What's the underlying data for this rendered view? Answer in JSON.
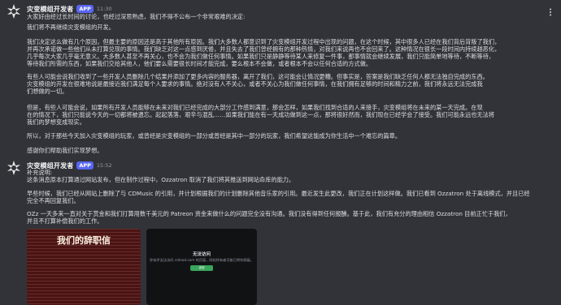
{
  "messages": [
    {
      "username": "灾变模组开发者",
      "badge": "APP",
      "time": "11:30",
      "lines": [
        "大家好由经过长时间的讨论，也经过深思熟虑，我们不得不公布一个非常艰难的决定:",
        "我们将不再继续灾变模组的开发。",
        "我们决定这么做有几个原因，但最主要的原因还是高于其他所有原因。我们大多数人都意识到了灾变模组开发过程中出现的问题，在这个时候，其中很多人已经在我们背后背叛了我们，",
        "并再次承诺做一些他们从未打算兑现的事情。我们缺乏对这一点感到厌倦，并且失去了我们曾经拥有的那种热情，对我们来说再也不会回来了。这种情况在很长一段时间内持续越恶化，",
        "几乎每次大家几乎毫无意义。大多数人甚至不再关心，也不会为我们做任何事情。如果我们只是静静等待某人来修复一件事，那事情就会继续发展，我们只能简单地等待，不断等待，",
        "等待我们所需的东西，如果我们交给其他人，他们要么需要很长时间才能完成，要么根本不会做，或者根本不会以任何合适的方式做。",
        "有些人可能会说我们收到了一些开发人员删除几个结果并添加了更多内容的服务器，离开了我们，这可能会让情况更糟。但事实是，答案是我们缺乏任何人都无法独自完成的东西。",
        "灾变模组的开发在很难地说是最接近我们满足每个人要求的事情。绝对没有人不关心，或者不关心为我们做任何事情，在我们拥有足够的时间和精力之前，我们将永远无法完成我",
        "们想做的一切。",
        "但是，有些人可能会说，如果所有开发人员能够在未来对我们已经完成的大部分工作感到满意，那会怎样，如果我们找到合适的人来接手，灾变模组将在未来的某一天完成。在现",
        "在的情况下，我们只能说今天的一切都将被遗忘。起起落落，艰辛与混乱……如果我们能在有一天成功做到这一点，那将很好然而，我们现在已经学会了接受。我们可能永远也无法将",
        "我们的梦想变成现实。",
        "所以，对于那些今天加入灾变模组的玩家，或曾经是灾变模组的一部分或曾经是其中一部分的玩家，我们希望这能成为你生活中一个难忘的篇章。",
        "感谢你们帮助我们实现梦想。"
      ]
    },
    {
      "username": "灾变模组开发者",
      "badge": "APP",
      "time": "15:52",
      "lines": [
        "补充说明:",
        "这条消息原本打算通过网站发布，但在制作过程中，Ozzatron 取消了我们将其推送到网站命库的能力。",
        "早些时候，我们已经从网站上删除了与 CDMusic 的引用，并计划根据我们的计划删除其他音乐家的引用。最近发生此更改，我们正在计划这样做。我们已看到 Ozzatron 处于离线模式，并且已经",
        "完全不再回复我们。",
        "OZz 一天多来一直对关于赏金和我们打算用数千美元的 Patreon 资金来做什么的问题完全没有沟通。我们没有得到任何报酬。基于此，我们有充分的理由相信 Ozzatron 目前正忙于我们，",
        "并且不打算补偿我们的工作。"
      ]
    }
  ],
  "attachments": {
    "document_title": "我们的辞职信",
    "error_title": "无法访问",
    "error_desc": "你似乎无法访问 cdmod.com 的页面，网站所有者可能已将你屏蔽。",
    "error_button": "返回"
  },
  "icons": {
    "avatar": "bot-skull-icon",
    "more": "more-options-icon"
  },
  "colors": {
    "background": "#313338",
    "badge": "#5865f2",
    "text": "#dbdee1"
  }
}
